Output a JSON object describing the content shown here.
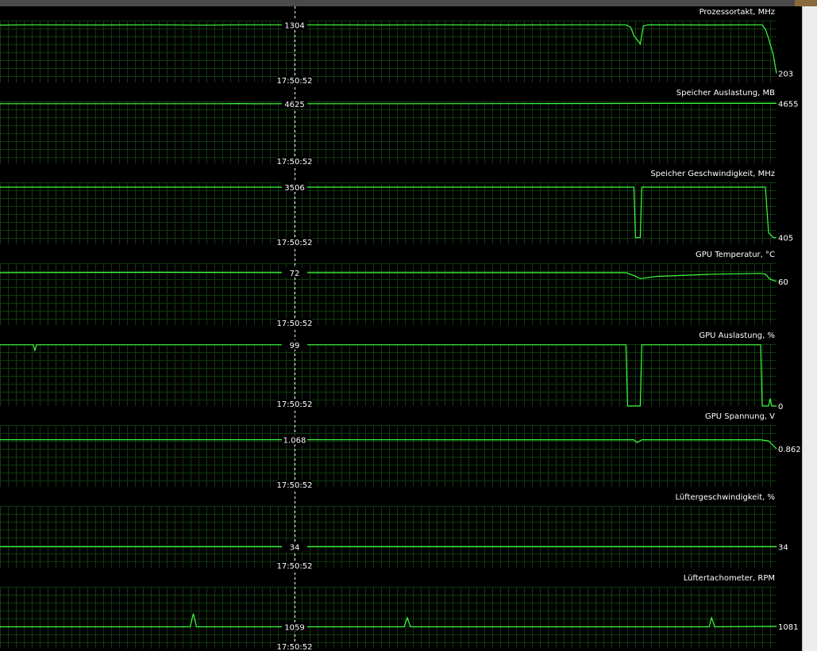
{
  "colors": {
    "background": "#000000",
    "grid": "#0f3a0f",
    "line": "#3cff3c",
    "text": "#ffffff",
    "cursor": "#ffffff",
    "scrollbar": "#ececec"
  },
  "cursor": {
    "time": "17:50:52"
  },
  "graphs": [
    {
      "id": "core-clock",
      "title": "Prozessortakt, MHz",
      "cursor_value": "1304",
      "current_value": "203",
      "series": {
        "min": 0,
        "max": 1400,
        "points": [
          [
            0,
            1300
          ],
          [
            40,
            1304
          ],
          [
            120,
            1302
          ],
          [
            200,
            1304
          ],
          [
            260,
            1298
          ],
          [
            300,
            1304
          ],
          [
            380,
            1304
          ],
          [
            480,
            1302
          ],
          [
            560,
            1304
          ],
          [
            640,
            1302
          ],
          [
            720,
            1304
          ],
          [
            790,
            1304
          ],
          [
            796,
            1250
          ],
          [
            800,
            1060
          ],
          [
            808,
            870
          ],
          [
            812,
            1280
          ],
          [
            818,
            1304
          ],
          [
            900,
            1302
          ],
          [
            950,
            1304
          ],
          [
            962,
            1304
          ],
          [
            966,
            1200
          ],
          [
            970,
            1000
          ],
          [
            976,
            620
          ],
          [
            980,
            203
          ]
        ]
      }
    },
    {
      "id": "memory-usage",
      "title": "Speicher Auslastung, MB",
      "cursor_value": "4625",
      "current_value": "4655",
      "series": {
        "min": 0,
        "max": 4800,
        "points": [
          [
            0,
            4625
          ],
          [
            280,
            4625
          ],
          [
            300,
            4640
          ],
          [
            320,
            4620
          ],
          [
            360,
            4625
          ],
          [
            500,
            4630
          ],
          [
            700,
            4640
          ],
          [
            850,
            4650
          ],
          [
            980,
            4655
          ]
        ]
      }
    },
    {
      "id": "memory-clock",
      "title": "Speicher Geschwindigkeit, MHz",
      "cursor_value": "3506",
      "current_value": "405",
      "series": {
        "min": 0,
        "max": 3800,
        "points": [
          [
            0,
            3506
          ],
          [
            800,
            3506
          ],
          [
            802,
            405
          ],
          [
            808,
            405
          ],
          [
            810,
            3506
          ],
          [
            966,
            3506
          ],
          [
            970,
            700
          ],
          [
            976,
            405
          ],
          [
            980,
            405
          ]
        ]
      }
    },
    {
      "id": "gpu-temperature",
      "title": "GPU Temperatur, °C",
      "cursor_value": "72",
      "current_value": "60",
      "series": {
        "min": 0,
        "max": 85,
        "points": [
          [
            0,
            72
          ],
          [
            200,
            72.5
          ],
          [
            380,
            72
          ],
          [
            600,
            72
          ],
          [
            790,
            72
          ],
          [
            800,
            68
          ],
          [
            808,
            64
          ],
          [
            830,
            67
          ],
          [
            900,
            70
          ],
          [
            960,
            71
          ],
          [
            966,
            70
          ],
          [
            972,
            63
          ],
          [
            980,
            60
          ]
        ]
      }
    },
    {
      "id": "gpu-load",
      "title": "GPU Auslastung, %",
      "cursor_value": "99",
      "current_value": "0",
      "series": {
        "min": 0,
        "max": 100,
        "points": [
          [
            0,
            99
          ],
          [
            42,
            99
          ],
          [
            44,
            90
          ],
          [
            46,
            99
          ],
          [
            300,
            99
          ],
          [
            600,
            99
          ],
          [
            790,
            99
          ],
          [
            792,
            0
          ],
          [
            808,
            0
          ],
          [
            810,
            99
          ],
          [
            960,
            99
          ],
          [
            962,
            0
          ],
          [
            970,
            0
          ],
          [
            972,
            12
          ],
          [
            974,
            0
          ],
          [
            980,
            0
          ]
        ]
      }
    },
    {
      "id": "gpu-voltage",
      "title": "GPU Spannung, V",
      "cursor_value": "1.068",
      "current_value": "0.862",
      "series": {
        "min": 0,
        "max": 1.4,
        "points": [
          [
            0,
            1.068
          ],
          [
            300,
            1.068
          ],
          [
            600,
            1.066
          ],
          [
            800,
            1.066
          ],
          [
            804,
            1.0
          ],
          [
            810,
            1.066
          ],
          [
            960,
            1.066
          ],
          [
            970,
            1.04
          ],
          [
            980,
            0.862
          ]
        ]
      }
    },
    {
      "id": "fan-speed",
      "title": "Lüftergeschwindigkeit, %",
      "cursor_value": "34",
      "current_value": "34",
      "series": {
        "min": 0,
        "max": 100,
        "points": [
          [
            0,
            34
          ],
          [
            980,
            34
          ]
        ]
      }
    },
    {
      "id": "fan-tachometer",
      "title": "Lüftertachometer, RPM",
      "cursor_value": "1059",
      "current_value": "1081",
      "series": {
        "min": 0,
        "max": 3000,
        "points": [
          [
            0,
            1059
          ],
          [
            240,
            1059
          ],
          [
            244,
            1700
          ],
          [
            248,
            1059
          ],
          [
            510,
            1059
          ],
          [
            514,
            1500
          ],
          [
            518,
            1059
          ],
          [
            895,
            1059
          ],
          [
            898,
            1500
          ],
          [
            902,
            1059
          ],
          [
            980,
            1081
          ]
        ]
      }
    }
  ]
}
